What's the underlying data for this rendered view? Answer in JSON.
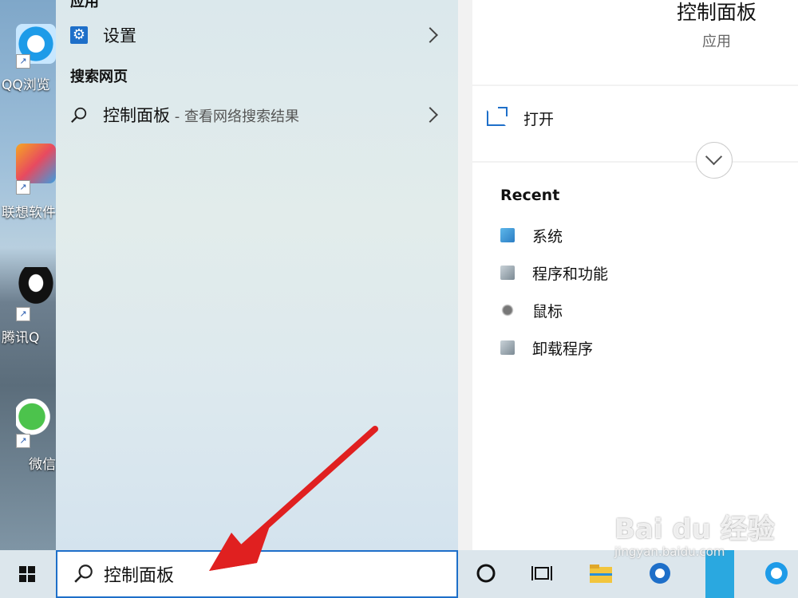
{
  "desktop": {
    "icons": [
      {
        "label": "QQ浏览"
      },
      {
        "label": "联想软件"
      },
      {
        "label": "腾讯Q"
      },
      {
        "label": "微信"
      }
    ]
  },
  "results": {
    "top_heading": "应用",
    "settings_label": "设置",
    "web_heading": "搜索网页",
    "web_result_label": "控制面板",
    "web_result_sub": " - 查看网络搜索结果"
  },
  "preview": {
    "title": "控制面板",
    "subtitle": "应用",
    "open_label": "打开",
    "recent_heading": "Recent",
    "recent_items": [
      {
        "label": "系统"
      },
      {
        "label": "程序和功能"
      },
      {
        "label": "鼠标"
      },
      {
        "label": "卸载程序"
      }
    ]
  },
  "taskbar": {
    "search_value": "控制面板"
  },
  "watermark": {
    "brand": "Bai du 经验",
    "url": "jingyan.baidu.com"
  },
  "colors": {
    "accent": "#1e6fc9",
    "arrow": "#e02020"
  }
}
